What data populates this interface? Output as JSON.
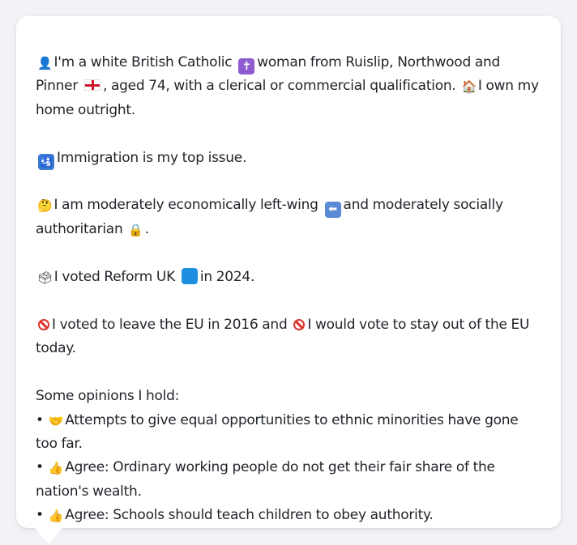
{
  "profile": {
    "line1": {
      "a": "I'm a white British Catholic",
      "b": "woman from Ruislip, Northwood and Pinner",
      "c": ", aged 74, with a clerical or commercial qualification.",
      "d": "I own my home outright."
    },
    "line2": "Immigration is my top issue.",
    "line3": {
      "a": "I am moderately economically left-wing",
      "b": "and moderately socially authoritarian",
      "c": "."
    },
    "line4": {
      "a": "I voted Reform UK",
      "b": "in 2024."
    },
    "line5": {
      "a": "I voted to leave the EU in 2016 and",
      "b": "I would vote to stay out of the EU today."
    },
    "opinions_heading": "Some opinions I hold:",
    "opinions": [
      {
        "bullet": "•",
        "text": "Attempts to give equal opportunities to ethnic minorities have gone too far."
      },
      {
        "bullet": "•",
        "text": "Agree: Ordinary working people do not get their fair share of the nation's wealth."
      },
      {
        "bullet": "•",
        "text": "Agree: Schools should teach children to obey authority."
      }
    ]
  },
  "icons": {
    "person": "bust-silhouette-icon",
    "cross": "latin-cross-icon",
    "flag": "england-flag-icon",
    "home": "house-icon",
    "immigration": "passport-control-icon",
    "thinking": "thinking-face-icon",
    "left": "left-arrow-icon",
    "lock": "lock-icon",
    "ballot": "ballot-box-icon",
    "reform": "blue-square-icon",
    "no": "prohibited-icon",
    "handshake": "handshake-icon",
    "thumbs": "thumbs-up-icon"
  },
  "colors": {
    "card_background": "#ffffff",
    "page_background": "#f1f3f6",
    "text": "#1f2328",
    "reform_blue": "#1e8fe0",
    "prohibited_red": "#e0332b"
  }
}
